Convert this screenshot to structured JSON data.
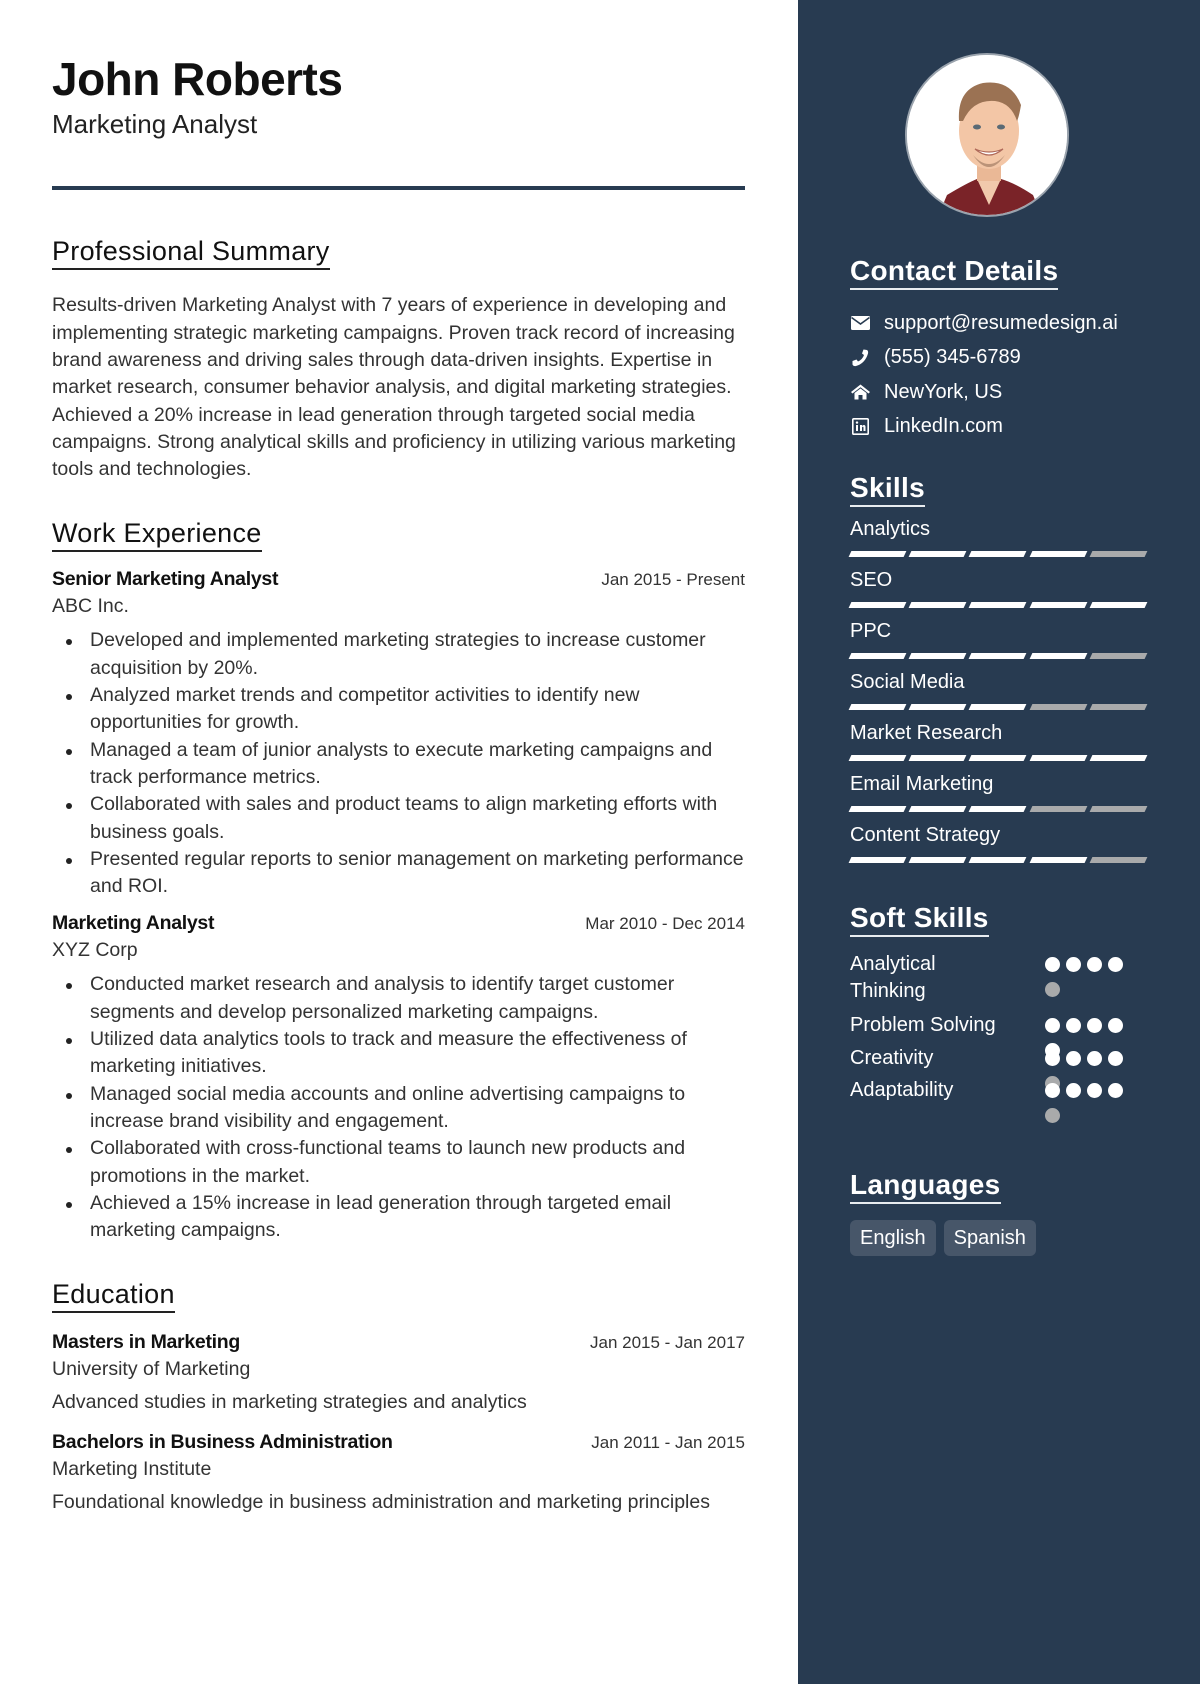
{
  "header": {
    "name": "John Roberts",
    "title": "Marketing Analyst"
  },
  "summary": {
    "heading": "Professional Summary",
    "text": "Results-driven Marketing Analyst with 7 years of experience in developing and implementing strategic marketing campaigns. Proven track record of increasing brand awareness and driving sales through data-driven insights. Expertise in market research, consumer behavior analysis, and digital marketing strategies. Achieved a 20% increase in lead generation through targeted social media campaigns. Strong analytical skills and proficiency in utilizing various marketing tools and technologies."
  },
  "work": {
    "heading": "Work Experience",
    "jobs": [
      {
        "title": "Senior Marketing Analyst",
        "date": "Jan 2015 - Present",
        "company": "ABC Inc.",
        "bullets": [
          "Developed and implemented marketing strategies to increase customer acquisition by 20%.",
          "Analyzed market trends and competitor activities to identify new opportunities for growth.",
          "Managed a team of junior analysts to execute marketing campaigns and track performance metrics.",
          "Collaborated with sales and product teams to align marketing efforts with business goals.",
          "Presented regular reports to senior management on marketing performance and ROI."
        ]
      },
      {
        "title": "Marketing Analyst",
        "date": "Mar 2010 - Dec 2014",
        "company": "XYZ Corp",
        "bullets": [
          "Conducted market research and analysis to identify target customer segments and develop personalized marketing campaigns.",
          "Utilized data analytics tools to track and measure the effectiveness of marketing initiatives.",
          "Managed social media accounts and online advertising campaigns to increase brand visibility and engagement.",
          "Collaborated with cross-functional teams to launch new products and promotions in the market.",
          "Achieved a 15% increase in lead generation through targeted email marketing campaigns."
        ]
      }
    ]
  },
  "education": {
    "heading": "Education",
    "items": [
      {
        "degree": "Masters in Marketing",
        "date": "Jan 2015 - Jan 2017",
        "school": "University of Marketing",
        "description": "Advanced studies in marketing strategies and analytics"
      },
      {
        "degree": "Bachelors in Business Administration",
        "date": "Jan 2011 - Jan 2015",
        "school": "Marketing Institute",
        "description": "Foundational knowledge in business administration and marketing principles"
      }
    ]
  },
  "sidebar": {
    "colors": {
      "background": "#283b51",
      "segment_on": "#ffffff",
      "segment_off": "#a9aaab",
      "pill": "#475669"
    },
    "contact": {
      "heading": "Contact Details",
      "items": [
        {
          "icon": "envelope-icon",
          "text": "support@resumedesign.ai"
        },
        {
          "icon": "phone-icon",
          "text": "(555) 345-6789"
        },
        {
          "icon": "home-icon",
          "text": "NewYork, US"
        },
        {
          "icon": "linkedin-icon",
          "text": "LinkedIn.com"
        }
      ]
    },
    "skills": {
      "heading": "Skills",
      "max": 5,
      "items": [
        {
          "label": "Analytics",
          "level": 4
        },
        {
          "label": "SEO",
          "level": 5
        },
        {
          "label": "PPC",
          "level": 4
        },
        {
          "label": "Social Media",
          "level": 3
        },
        {
          "label": "Market Research",
          "level": 5
        },
        {
          "label": "Email Marketing",
          "level": 3
        },
        {
          "label": "Content Strategy",
          "level": 4
        }
      ]
    },
    "soft_skills": {
      "heading": "Soft Skills",
      "max": 5,
      "items": [
        {
          "label": "Analytical Thinking",
          "level": 4
        },
        {
          "label": "Problem Solving",
          "level": 5
        },
        {
          "label": "Creativity",
          "level": 4
        },
        {
          "label": "Adaptability",
          "level": 4
        }
      ]
    },
    "languages": {
      "heading": "Languages",
      "items": [
        "English",
        "Spanish"
      ]
    }
  }
}
